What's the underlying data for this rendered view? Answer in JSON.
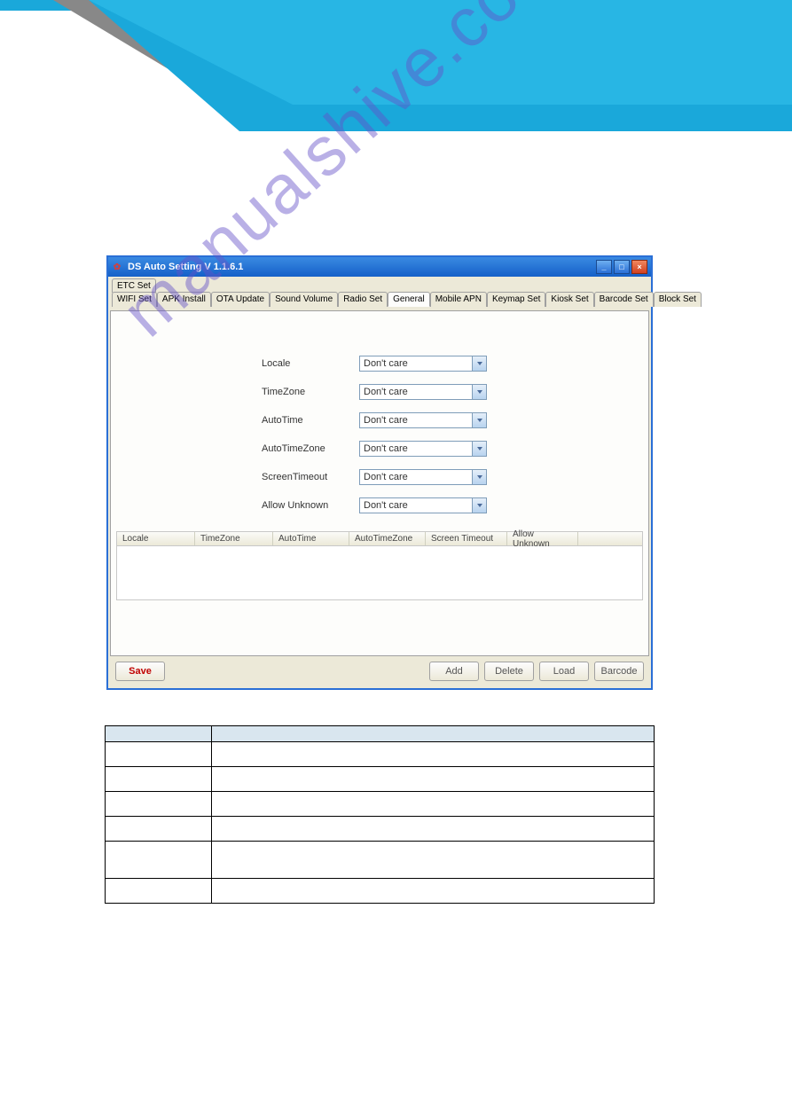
{
  "banner": {},
  "section_number": "",
  "window": {
    "title": "DS Auto Setting   V 1.1.6.1",
    "tabs_top": [
      "ETC Set"
    ],
    "tabs_main": [
      "WIFI Set",
      "APK Install",
      "OTA Update",
      "Sound Volume",
      "Radio Set",
      "General",
      "Mobile APN",
      "Keymap Set",
      "Kiosk Set",
      "Barcode Set",
      "Block Set"
    ],
    "active_tab": "General",
    "fields": [
      {
        "label": "Locale",
        "value": "Don't care"
      },
      {
        "label": "TimeZone",
        "value": "Don't care"
      },
      {
        "label": "AutoTime",
        "value": "Don't care"
      },
      {
        "label": "AutoTimeZone",
        "value": "Don't care"
      },
      {
        "label": "ScreenTimeout",
        "value": "Don't care"
      },
      {
        "label": "Allow Unknown",
        "value": "Don't care"
      }
    ],
    "list_headers": [
      "Locale",
      "TimeZone",
      "AutoTime",
      "AutoTimeZone",
      "Screen Timeout",
      "Allow Unknown"
    ],
    "buttons": {
      "save": "Save",
      "add": "Add",
      "delete": "Delete",
      "load": "Load",
      "barcode": "Barcode"
    }
  },
  "info_table": {
    "headers": [
      "",
      ""
    ],
    "rows": [
      {
        "name": "",
        "desc": ""
      },
      {
        "name": "",
        "desc": ""
      },
      {
        "name": "",
        "desc": ""
      },
      {
        "name": "",
        "desc": ""
      },
      {
        "name": "",
        "desc": "",
        "tall": true
      },
      {
        "name": "",
        "desc": ""
      }
    ]
  },
  "watermark": "manualshive.com"
}
